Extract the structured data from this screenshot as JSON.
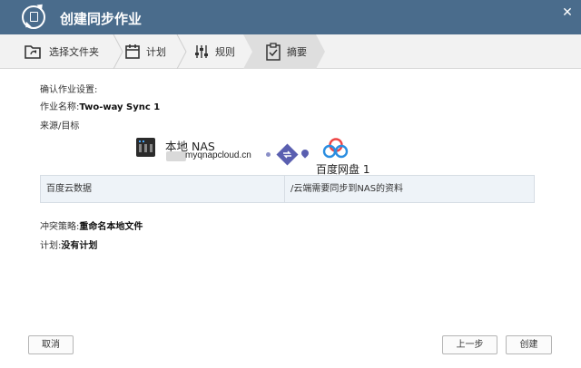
{
  "window": {
    "title": "创建同步作业",
    "close_glyph": "✕"
  },
  "steps": [
    {
      "label": "选择文件夹",
      "icon": "folder-sync-icon"
    },
    {
      "label": "计划",
      "icon": "calendar-icon"
    },
    {
      "label": "规则",
      "icon": "sliders-icon"
    },
    {
      "label": "摘要",
      "icon": "clipboard-icon",
      "active": true
    }
  ],
  "summary": {
    "heading": "确认作业设置:",
    "job_name_label": "作业名称:",
    "job_name_value": "Two-way Sync 1",
    "source_target_label": "来源/目标",
    "source": {
      "name": "本地 NAS",
      "host": "myqnapcloud.cn"
    },
    "target": {
      "name": "百度网盘 1"
    },
    "table": {
      "left": "百度云数据",
      "right": "/云端需要同步到NAS的资料"
    },
    "conflict_label": "冲突策略:",
    "conflict_value": "重命名本地文件",
    "schedule_label": "计划:",
    "schedule_value": "没有计划"
  },
  "buttons": {
    "cancel": "取消",
    "back": "上一步",
    "create": "创建"
  },
  "colors": {
    "titlebar": "#4a6c8c",
    "accent": "#5a5fb0"
  }
}
